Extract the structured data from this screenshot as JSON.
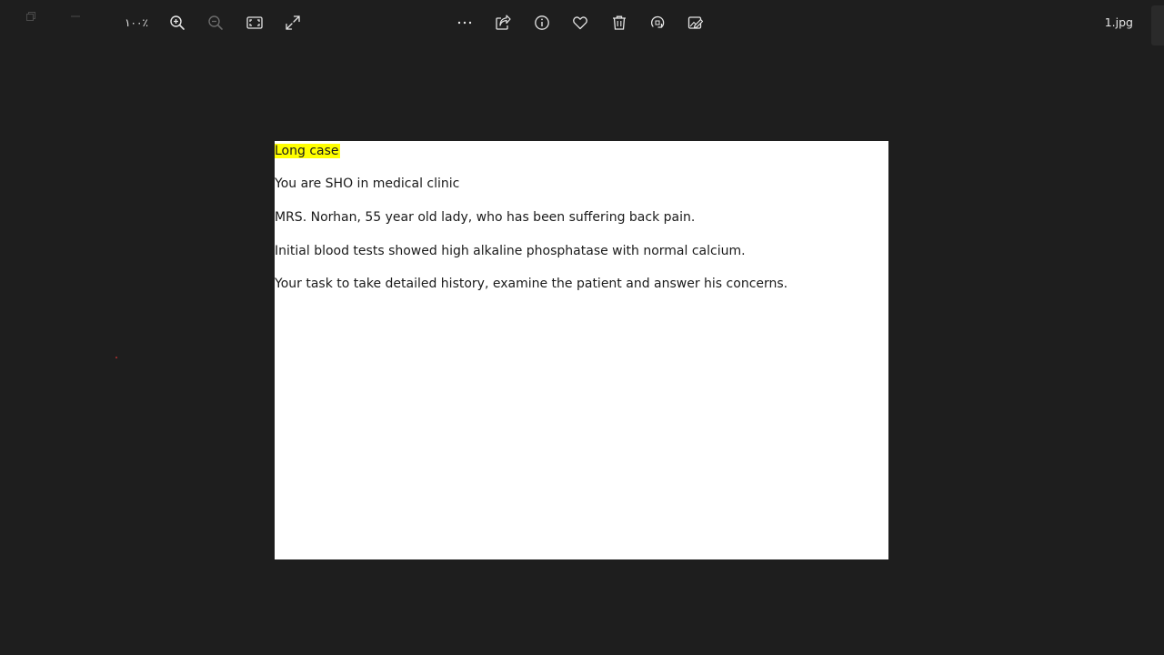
{
  "window": {
    "restore_icon": "restore-icon",
    "minimize_icon": "minimize-icon"
  },
  "toolbar": {
    "zoom_level": "١٠٠٪",
    "icons": {
      "zoom_in": "zoom-in-icon",
      "zoom_out": "zoom-out-icon",
      "fit": "fit-to-window-icon",
      "fullscreen": "fullscreen-icon",
      "more": "more-icon",
      "share": "share-icon",
      "info": "info-icon",
      "favorite": "heart-icon",
      "delete": "trash-icon",
      "rotate": "rotate-icon",
      "edit": "edit-icon"
    },
    "file_name": "1.jpg"
  },
  "document": {
    "heading": "Long case",
    "lines": [
      "You are SHO in medical clinic",
      "MRS. Norhan, 55 year old lady, who has been suffering back pain.",
      "Initial blood tests showed high alkaline phosphatase with normal calcium.",
      "Your task to take detailed history, examine the patient and answer his concerns."
    ],
    "highlight_color": "#ffff00"
  },
  "colors": {
    "background": "#1e1e1e",
    "toolbar_text": "#e6e6e6",
    "canvas": "#ffffff"
  }
}
